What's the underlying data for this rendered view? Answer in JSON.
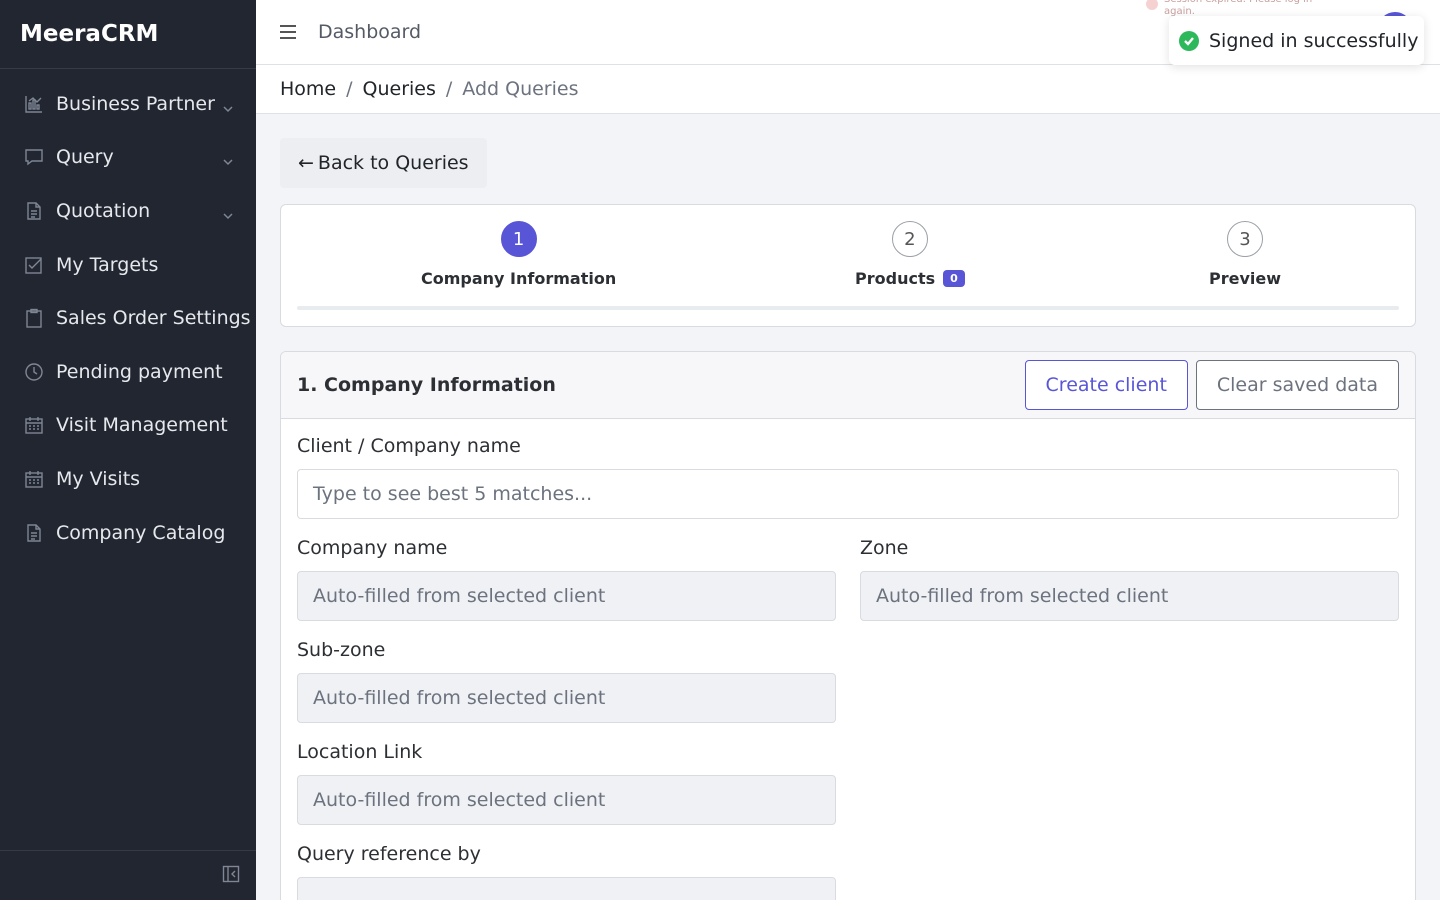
{
  "brand": "MeeraCRM",
  "sidebar": {
    "items": [
      {
        "label": "Business Partner",
        "icon": "chart-icon",
        "has_chevron": true
      },
      {
        "label": "Query",
        "icon": "chat-icon",
        "has_chevron": true
      },
      {
        "label": "Quotation",
        "icon": "document-icon",
        "has_chevron": true
      },
      {
        "label": "My Targets",
        "icon": "checkbox-icon",
        "has_chevron": false
      },
      {
        "label": "Sales Order Settings",
        "icon": "clipboard-icon",
        "has_chevron": false
      },
      {
        "label": "Pending payment",
        "icon": "clock-icon",
        "has_chevron": false
      },
      {
        "label": "Visit Management",
        "icon": "calendar-icon",
        "has_chevron": false
      },
      {
        "label": "My Visits",
        "icon": "calendar-icon",
        "has_chevron": false
      },
      {
        "label": "Company Catalog",
        "icon": "document-icon",
        "has_chevron": false
      }
    ]
  },
  "header": {
    "title": "Dashboard",
    "session_note": "Session expired. Please log in again."
  },
  "toast": {
    "message": "Signed in successfully",
    "color": "#2eb85c"
  },
  "breadcrumb": {
    "items": [
      "Home",
      "Queries",
      "Add Queries"
    ]
  },
  "back_button": {
    "label": "Back to Queries"
  },
  "stepper": {
    "steps": [
      {
        "number": "1",
        "label": "Company Information",
        "active": true
      },
      {
        "number": "2",
        "label": "Products",
        "badge": "0",
        "active": false
      },
      {
        "number": "3",
        "label": "Preview",
        "active": false
      }
    ]
  },
  "form": {
    "title": "1. Company Information",
    "create_client_label": "Create client",
    "clear_saved_label": "Clear saved data",
    "client_label": "Client / Company name",
    "client_placeholder": "Type to see best 5 matches...",
    "company_name_label": "Company name",
    "company_name_placeholder": "Auto-filled from selected client",
    "zone_label": "Zone",
    "zone_placeholder": "Auto-filled from selected client",
    "subzone_label": "Sub-zone",
    "subzone_placeholder": "Auto-filled from selected client",
    "location_label": "Location Link",
    "location_placeholder": "Auto-filled from selected client",
    "query_ref_label": "Query reference by"
  },
  "colors": {
    "accent": "#5856d6",
    "sidebar_bg": "#212631"
  }
}
